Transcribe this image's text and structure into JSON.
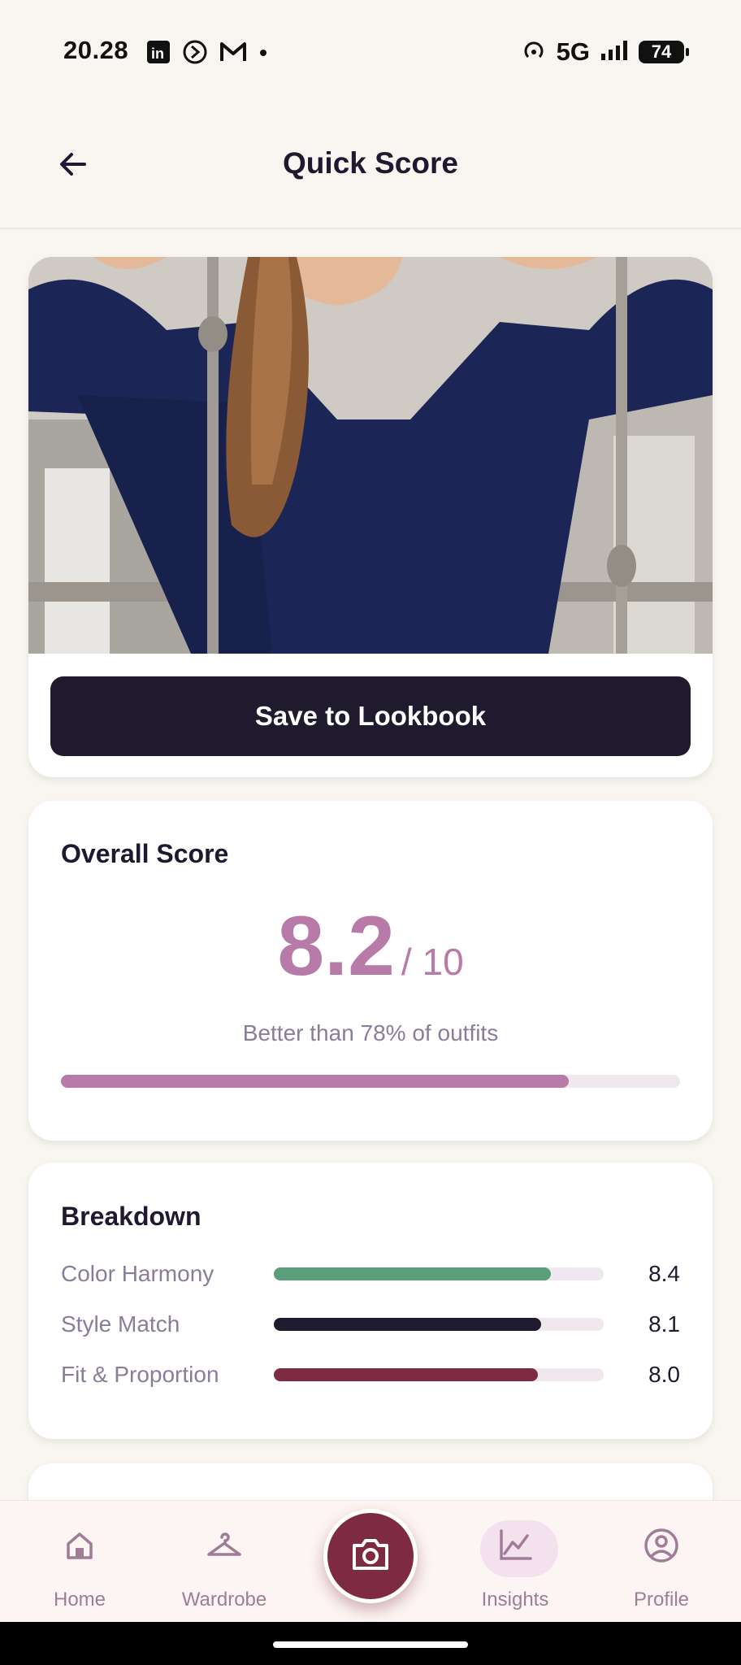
{
  "status_bar": {
    "time": "20.28",
    "network": "5G",
    "battery": "74",
    "left_icons": [
      "linkedin-icon",
      "app-icon",
      "gmail-icon",
      "dot-icon"
    ],
    "right_icons": [
      "hotspot-icon",
      "signal-icon",
      "battery-icon"
    ]
  },
  "app_bar": {
    "title": "Quick Score",
    "back_icon": "arrow-left-icon"
  },
  "photo_card": {
    "image_description": "outfit-photo",
    "save_label": "Save to Lookbook"
  },
  "overall": {
    "title": "Overall Score",
    "score": "8.2",
    "out_of": "/ 10",
    "comparison": "Better than 78% of outfits",
    "progress_fraction": 0.82,
    "accent_color": "#b87aa8"
  },
  "breakdown": {
    "title": "Breakdown",
    "items": [
      {
        "label": "Color Harmony",
        "value": "8.4",
        "fraction": 0.84,
        "color": "#5a9e7a"
      },
      {
        "label": "Style Match",
        "value": "8.1",
        "fraction": 0.81,
        "color": "#201a2e"
      },
      {
        "label": "Fit & Proportion",
        "value": "8.0",
        "fraction": 0.8,
        "color": "#7e2a42"
      }
    ]
  },
  "bottom_nav": {
    "items": [
      {
        "label": "Home",
        "icon": "home-icon"
      },
      {
        "label": "Wardrobe",
        "icon": "hanger-icon"
      },
      {
        "label": "",
        "icon": "camera-icon"
      },
      {
        "label": "Insights",
        "icon": "chart-line-icon",
        "active": true
      },
      {
        "label": "Profile",
        "icon": "user-circle-icon"
      }
    ]
  }
}
